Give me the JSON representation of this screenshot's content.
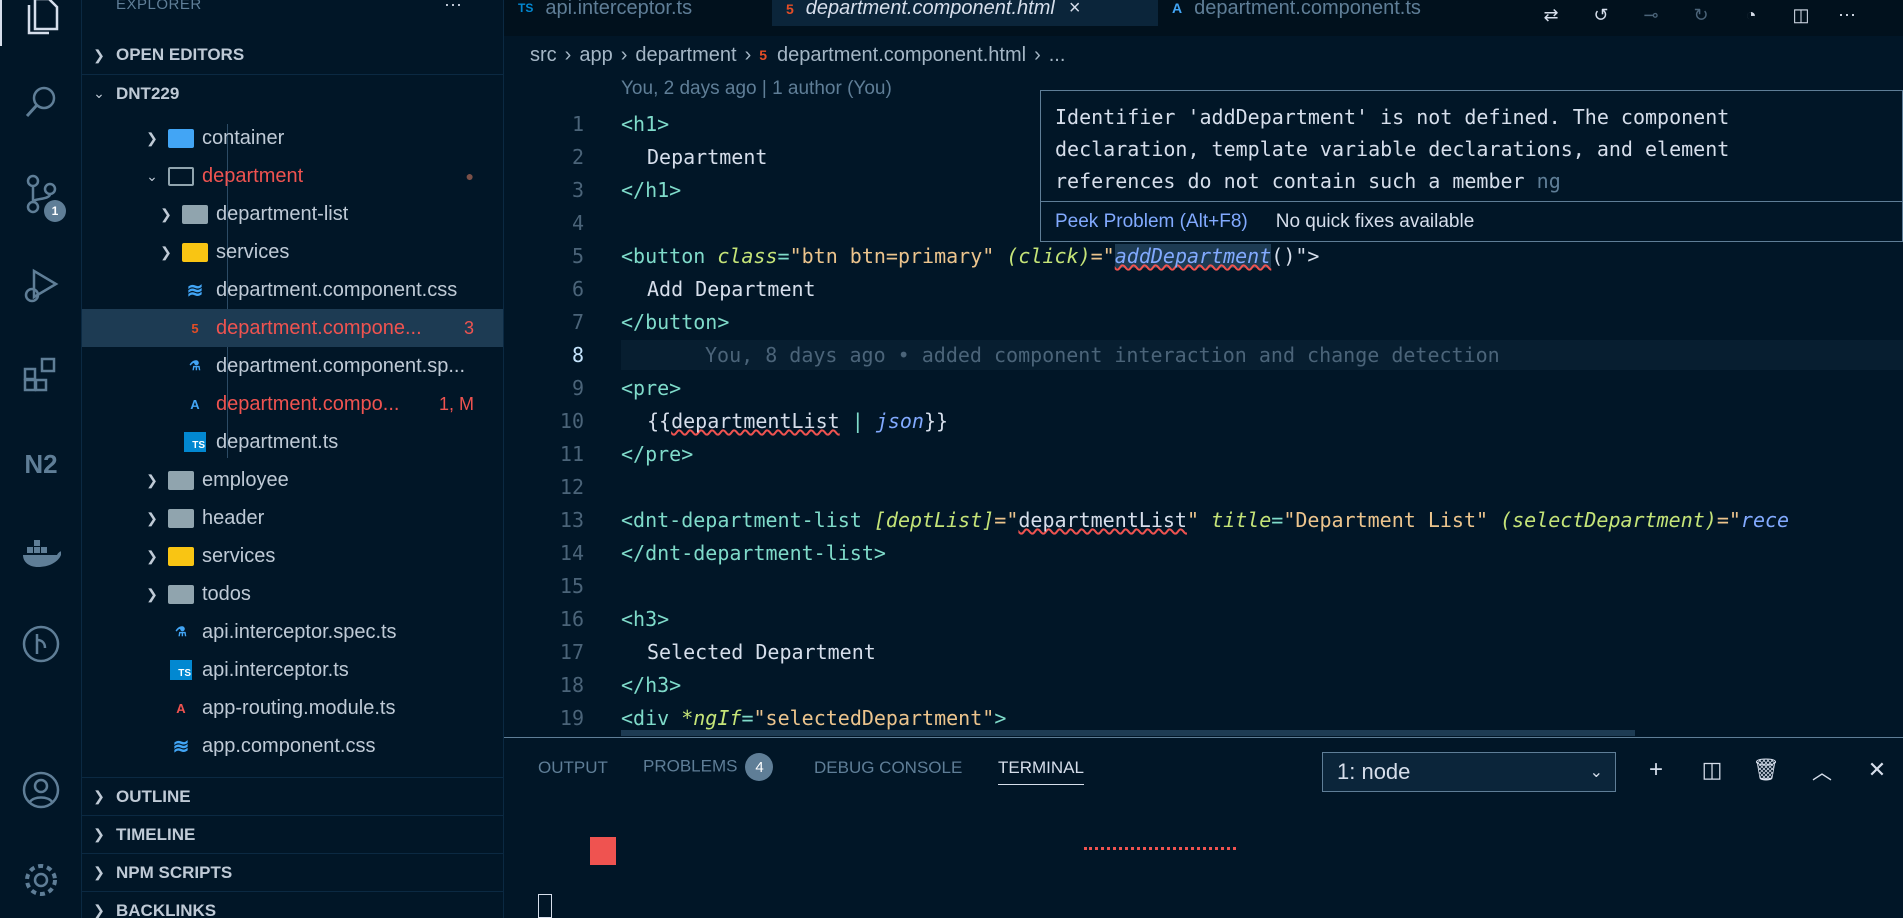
{
  "sidebar": {
    "title": "EXPLORER",
    "more_label": "···",
    "sections": {
      "open_editors": "OPEN EDITORS",
      "project": "DNT229",
      "outline": "OUTLINE",
      "timeline": "TIMELINE",
      "npm_scripts": "NPM SCRIPTS",
      "backlinks": "BACKLINKS"
    },
    "items": [
      {
        "label": "container",
        "decoration": ""
      },
      {
        "label": "department",
        "decoration": "●"
      },
      {
        "label": "department-list",
        "decoration": ""
      },
      {
        "label": "services",
        "decoration": ""
      },
      {
        "label": "department.component.css",
        "decoration": ""
      },
      {
        "label": "department.compone...",
        "decoration": "3"
      },
      {
        "label": "department.component.sp...",
        "decoration": ""
      },
      {
        "label": "department.compo...",
        "decoration": "1, M"
      },
      {
        "label": "department.ts",
        "decoration": ""
      },
      {
        "label": "employee",
        "decoration": ""
      },
      {
        "label": "header",
        "decoration": ""
      },
      {
        "label": "services",
        "decoration": ""
      },
      {
        "label": "todos",
        "decoration": ""
      },
      {
        "label": "api.interceptor.spec.ts",
        "decoration": ""
      },
      {
        "label": "api.interceptor.ts",
        "decoration": ""
      },
      {
        "label": "app-routing.module.ts",
        "decoration": ""
      },
      {
        "label": "app.component.css",
        "decoration": ""
      }
    ]
  },
  "activity": {
    "scm_badge": "1"
  },
  "tabs": [
    {
      "label": "api.interceptor.ts",
      "icon": "TS"
    },
    {
      "label": "department.component.html",
      "icon": "5",
      "close": "×"
    },
    {
      "label": "department.component.ts",
      "icon": "A"
    }
  ],
  "breadcrumb": [
    "src",
    "app",
    "department",
    "department.component.html",
    "..."
  ],
  "editor": {
    "blame_header": "You, 2 days ago | 1 author (You)",
    "line_numbers": [
      "1",
      "2",
      "3",
      "4",
      "5",
      "6",
      "7",
      "8",
      "9",
      "10",
      "11",
      "12",
      "13",
      "14",
      "15",
      "16",
      "17",
      "18",
      "19"
    ],
    "lines": {
      "l1": "<h1>",
      "l2": "Department",
      "l3": "</h1>",
      "l5_open": "<button ",
      "l5_attr1": "class",
      "l5_eq1": "=",
      "l5_val1": "\"btn btn=primary\"",
      "l5_attr2": "(click)",
      "l5_eq2": "=\"",
      "l5_fn": "addDepartment",
      "l5_rest": "()\">",
      "l6": "Add Department",
      "l7": "</button>",
      "l8_blame": "You, 8 days ago • added component interaction and change detection",
      "l9": "<pre>",
      "l10_open": "{{",
      "l10_var": "departmentList",
      "l10_pipe": " | ",
      "l10_fn": "json",
      "l10_close": "}}",
      "l11": "</pre>",
      "l13_open": "<dnt-department-list ",
      "l13_attr1": "[deptList]",
      "l13_eq1": "=\"",
      "l13_val1": "departmentList",
      "l13_q1": "\" ",
      "l13_attr2": "title",
      "l13_eq2": "=",
      "l13_val2": "\"Department List\"",
      "l13_attr3": "(selectDepartment)",
      "l13_eq3": "=\"",
      "l13_fn3": "rece",
      "l14": "</dnt-department-list>",
      "l16": "<h3>",
      "l17": "Selected Department",
      "l18": "</h3>",
      "l19_open": "<div ",
      "l19_attr": "*ngIf",
      "l19_eq": "=",
      "l19_val": "\"selectedDepartment\"",
      "l19_close": ">"
    }
  },
  "hover": {
    "message": "Identifier 'addDepartment' is not defined. The component\ndeclaration, template variable declarations, and element\nreferences do not contain such a member",
    "source": "ng",
    "peek": "Peek Problem (Alt+F8)",
    "no_fix": "No quick fixes available"
  },
  "panel": {
    "tabs": [
      "OUTPUT",
      "PROBLEMS",
      "DEBUG CONSOLE",
      "TERMINAL"
    ],
    "problems_count": "4",
    "terminal_select": "1: node",
    "icons": [
      "plus-icon",
      "split-icon",
      "trash-icon",
      "chevron-up-icon",
      "close-icon"
    ]
  }
}
